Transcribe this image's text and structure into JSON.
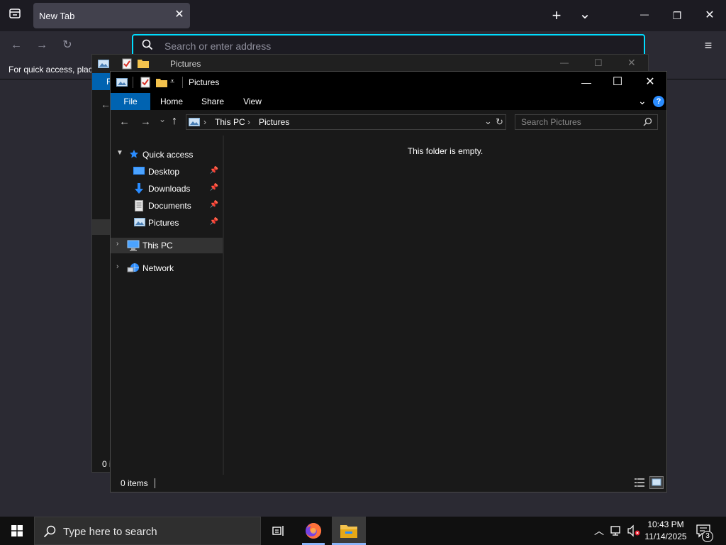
{
  "firefox": {
    "tab_title": "New Tab",
    "tab_close": "✕",
    "new_tab": "+",
    "list_tabs": "⌄",
    "minimize": "—",
    "restore": "❐",
    "close": "✕",
    "back": "←",
    "forward": "→",
    "reload": "↻",
    "url_placeholder": "Search or enter address",
    "menu": "≡",
    "bookmark_hint": "For quick access, place"
  },
  "back_window": {
    "title": "Pictures",
    "ribbon_file_partial": "F",
    "status_partial": "0 i"
  },
  "explorer": {
    "title": "Pictures",
    "minimize": "—",
    "maximize": "☐",
    "close": "✕",
    "ribbon_tabs": [
      "File",
      "Home",
      "Share",
      "View"
    ],
    "help": "?",
    "nav_back": "←",
    "nav_forward": "→",
    "nav_recent": "⌄",
    "nav_up": "↑",
    "breadcrumb": [
      "This PC",
      "Pictures"
    ],
    "breadcrumb_sep": "›",
    "address_dropdown": "⌄",
    "address_refresh": "↻",
    "search_placeholder": "Search Pictures",
    "nav_pane": {
      "quick_access": "Quick access",
      "items": [
        "Desktop",
        "Downloads",
        "Documents",
        "Pictures"
      ],
      "this_pc": "This PC",
      "network": "Network"
    },
    "empty_message": "This folder is empty.",
    "status": "0 items"
  },
  "taskbar": {
    "search_placeholder": "Type here to search",
    "time": "10:43 PM",
    "date": "11/14/2025",
    "notification_count": "3"
  },
  "colors": {
    "firefox_accent": "#00ddff",
    "explorer_file_tab": "#0063b1",
    "quick_access_star": "#2a8cff"
  }
}
